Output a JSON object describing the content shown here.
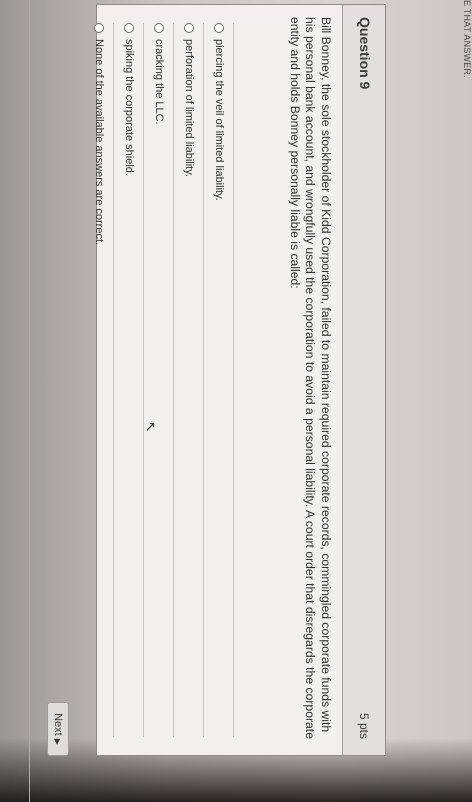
{
  "page": {
    "top_strip_text": "E THAT ANSWER."
  },
  "question": {
    "title": "Question 9",
    "points": "5 pts",
    "text": "Bill Bonney, the sole stockholder of Kidd Corporation, failed to maintain required corporate records, commingled corporate funds with his personal bank account, and wrongfully used the corporation to avoid a personal liability. A court order that disregards the corporate entity and holds Bonney personally liable is called:"
  },
  "answers": [
    {
      "label": "piercing the veil of limited liability."
    },
    {
      "label": "perforation of limited liability."
    },
    {
      "label": "cracking the LLC."
    },
    {
      "label": "spiking the corporate shield."
    },
    {
      "label": "None of the available answers are correct."
    }
  ],
  "navigation": {
    "next_label": "Next",
    "next_arrow": "▶"
  },
  "icons": {
    "radio": "radio-button-icon",
    "pointer": "mouse-pointer-icon",
    "arrow": "arrow-right-icon"
  },
  "colors": {
    "card_background": "#f2f0ee",
    "header_background": "#e2e0de",
    "border": "#8f8d8b",
    "text": "#2f2f2f"
  }
}
